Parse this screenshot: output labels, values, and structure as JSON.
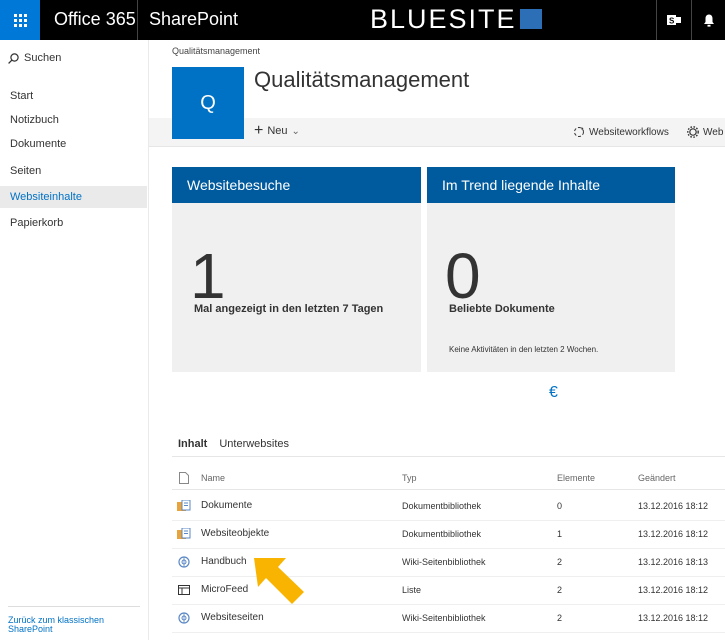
{
  "suite": {
    "app_name": "Office 365",
    "product": "SharePoint",
    "brand": "BLUESITE"
  },
  "nav": {
    "search_label": "Suchen",
    "items": [
      {
        "label": "Start",
        "selected": false
      },
      {
        "label": "Notizbuch",
        "selected": false
      },
      {
        "label": "Dokumente",
        "selected": false
      },
      {
        "label": "Seiten",
        "selected": false
      },
      {
        "label": "Websiteinhalte",
        "selected": true
      },
      {
        "label": "Papierkorb",
        "selected": false
      }
    ],
    "back_link": "Zurück zum klassischen SharePoint"
  },
  "header": {
    "breadcrumb": "Qualitätsmanagement",
    "site_initial": "Q",
    "site_title": "Qualitätsmanagement"
  },
  "commands": {
    "new_label": "Neu",
    "workflows_label": "Websiteworkflows",
    "settings_label": "Web"
  },
  "cards": [
    {
      "title": "Websitebesuche",
      "value": "1",
      "caption": "Mal angezeigt in den letzten 7 Tagen",
      "note": ""
    },
    {
      "title": "Im Trend liegende Inhalte",
      "value": "0",
      "caption": "Beliebte Dokumente",
      "note": "Keine Aktivitäten in den letzten 2 Wochen."
    }
  ],
  "euro_symbol": "€",
  "tabs": [
    {
      "label": "Inhalt",
      "active": true
    },
    {
      "label": "Unterwebsites",
      "active": false
    }
  ],
  "table": {
    "headers": {
      "name": "Name",
      "type": "Typ",
      "items": "Elemente",
      "modified": "Geändert"
    },
    "rows": [
      {
        "icon": "document-library-icon",
        "name": "Dokumente",
        "type": "Dokumentbibliothek",
        "items": "0",
        "modified": "13.12.2016 18:12"
      },
      {
        "icon": "document-library-icon",
        "name": "Websiteobjekte",
        "type": "Dokumentbibliothek",
        "items": "1",
        "modified": "13.12.2016 18:12"
      },
      {
        "icon": "wiki-library-icon",
        "name": "Handbuch",
        "type": "Wiki-Seitenbibliothek",
        "items": "2",
        "modified": "13.12.2016 18:13"
      },
      {
        "icon": "list-icon",
        "name": "MicroFeed",
        "type": "Liste",
        "items": "2",
        "modified": "13.12.2016 18:12"
      },
      {
        "icon": "wiki-library-icon",
        "name": "Websiteseiten",
        "type": "Wiki-Seitenbibliothek",
        "items": "2",
        "modified": "13.12.2016 18:12"
      }
    ]
  },
  "colors": {
    "suite_bar": "#000000",
    "accent": "#0072c6",
    "card_header": "#005a9e",
    "highlight_arrow": "#f8b400"
  }
}
